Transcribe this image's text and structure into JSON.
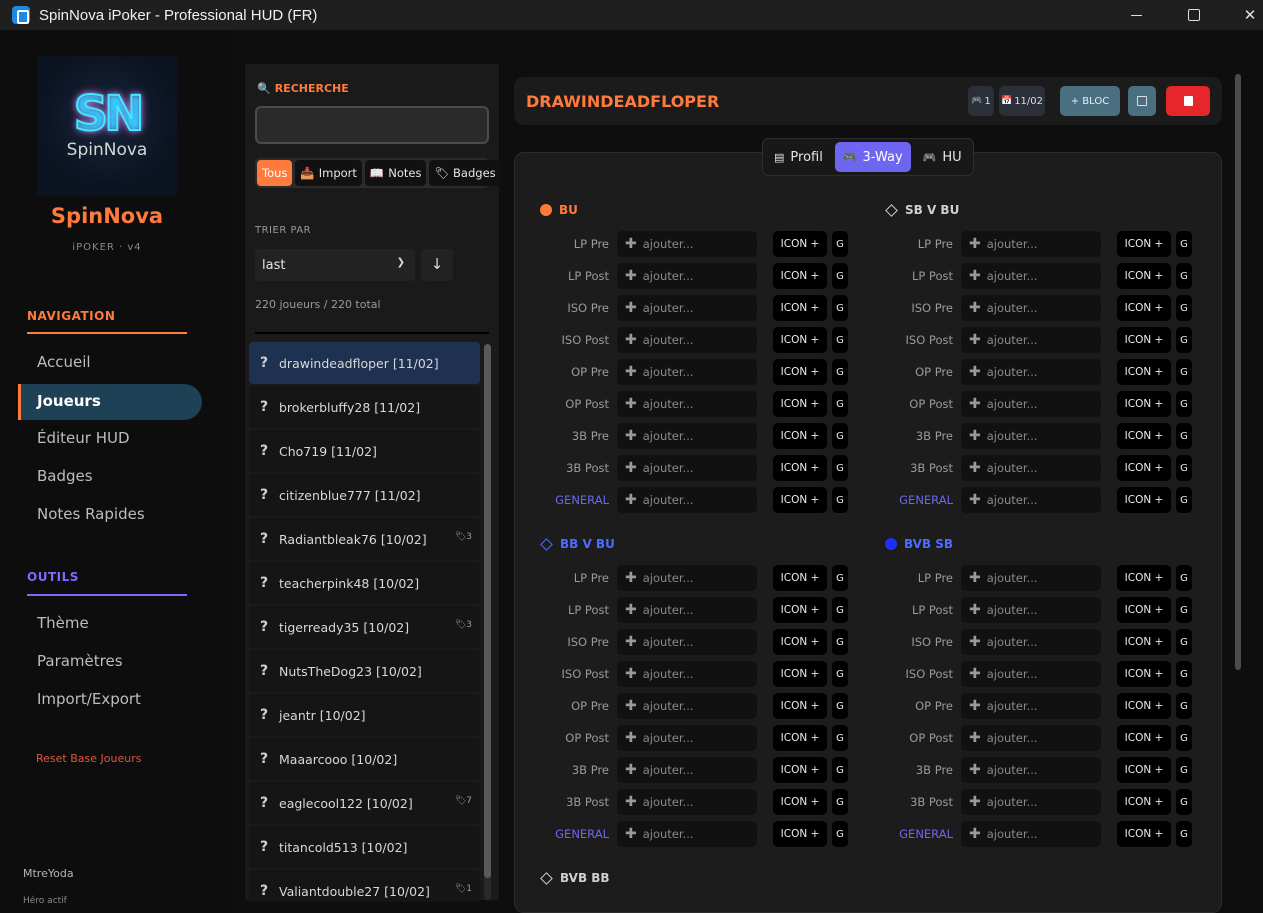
{
  "window": {
    "title": "SpinNova iPoker - Professional HUD (FR)"
  },
  "sidebar": {
    "logo_word": "SpinNova",
    "brand_name": "SpinNova",
    "brand_sub": "iPOKER · v4",
    "nav_title": "NAVIGATION",
    "nav_items": [
      {
        "label": "Accueil"
      },
      {
        "label": "Joueurs",
        "active": true
      },
      {
        "label": "Éditeur HUD"
      },
      {
        "label": "Badges"
      },
      {
        "label": "Notes Rapides"
      }
    ],
    "tools_title": "OUTILS",
    "tools_items": [
      {
        "label": "Thème"
      },
      {
        "label": "Paramètres"
      },
      {
        "label": "Import/Export"
      }
    ],
    "reset_label": "Reset Base Joueurs",
    "user_name": "MtreYoda",
    "user_status": "Héro actif"
  },
  "player_list": {
    "search_label": "RECHERCHE",
    "search_value": "",
    "filters": [
      {
        "label": "Tous",
        "active": true,
        "icon": ""
      },
      {
        "label": "Import",
        "icon": "📥"
      },
      {
        "label": "Notes",
        "icon": "📖"
      },
      {
        "label": "Badges",
        "icon": "🏷"
      }
    ],
    "sort_label": "TRIER PAR",
    "sort_value": "last",
    "sort_dir_icon": "↓",
    "count_text": "220 joueurs / 220 total",
    "players": [
      {
        "name": "drawindeadfloper [11/02]",
        "badge": "",
        "selected": true
      },
      {
        "name": "brokerbluffy28 [11/02]",
        "badge": ""
      },
      {
        "name": "Cho719 [11/02]",
        "badge": ""
      },
      {
        "name": "citizenblue777 [11/02]",
        "badge": ""
      },
      {
        "name": "Radiantbleak76 [10/02]",
        "badge": "3"
      },
      {
        "name": "teacherpink48 [10/02]",
        "badge": ""
      },
      {
        "name": "tigerready35 [10/02]",
        "badge": "3"
      },
      {
        "name": "NutsTheDog23 [10/02]",
        "badge": ""
      },
      {
        "name": "jeantr [10/02]",
        "badge": ""
      },
      {
        "name": "Maaarcooo [10/02]",
        "badge": ""
      },
      {
        "name": "eaglecool122 [10/02]",
        "badge": "7"
      },
      {
        "name": "titancold513 [10/02]",
        "badge": ""
      },
      {
        "name": "Valiantdouble27 [10/02]",
        "badge": "1"
      }
    ]
  },
  "header": {
    "player_title": "DRAWINDEADFLOPER",
    "count_label": "1",
    "date_label": "11/02",
    "bloc_label": "+ BLOC"
  },
  "tabs": [
    {
      "label": "Profil",
      "icon": "📋"
    },
    {
      "label": "3-Way",
      "icon": "🎮",
      "active": true
    },
    {
      "label": "HU",
      "icon": "🎮"
    }
  ],
  "row_labels": [
    "LP Pre",
    "LP Post",
    "ISO Pre",
    "ISO Post",
    "OP Pre",
    "OP Post",
    "3B Pre",
    "3B Post",
    "GENERAL"
  ],
  "input_placeholder": "ajouter...",
  "icon_button": "ICON +",
  "extra_button": "G",
  "groups": [
    {
      "title": "BU",
      "marker": "dot-orange"
    },
    {
      "title": "SB V BU",
      "marker": "diamond-gray"
    },
    {
      "title": "BB V BU",
      "marker": "diamond-blue"
    },
    {
      "title": "BVB SB",
      "marker": "dot-blue"
    },
    {
      "title": "BVB BB",
      "marker": "diamond-gray"
    }
  ],
  "colors": {
    "accent_orange": "#ff7a3d",
    "accent_purple": "#6e66f0",
    "accent_blue": "#4d6bff",
    "danger": "#e5262b"
  }
}
